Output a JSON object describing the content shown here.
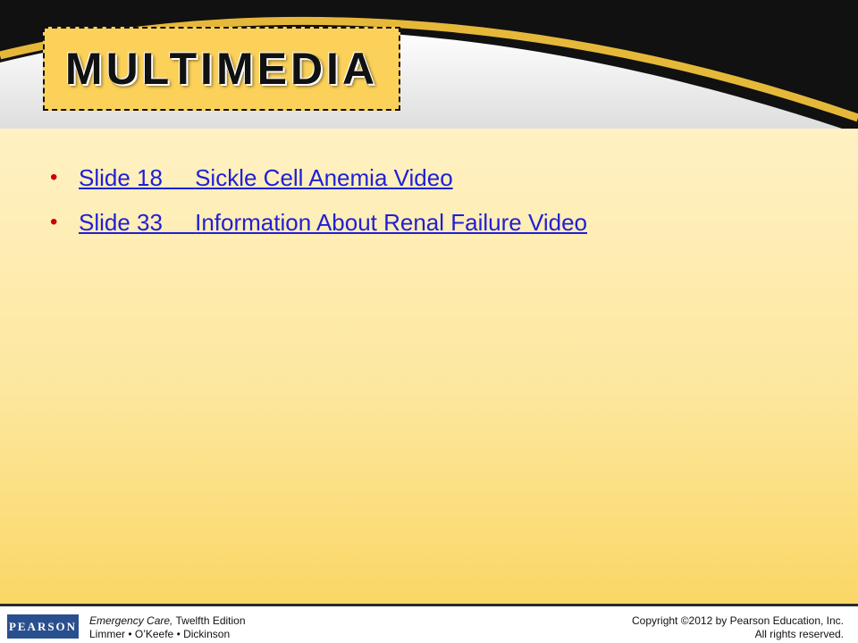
{
  "title": "MULTIMEDIA",
  "links": [
    {
      "slide": "Slide 18",
      "text": "Sickle Cell Anemia Video"
    },
    {
      "slide": "Slide 33",
      "text": "Information About Renal Failure Video"
    }
  ],
  "footer": {
    "logo": "PEARSON",
    "book_title": "Emergency Care,",
    "edition": " Twelfth Edition",
    "authors": "Limmer • O’Keefe • Dickinson",
    "copyright": "Copyright ©2012 by Pearson Education, Inc.",
    "rights": "All rights reserved."
  },
  "colors": {
    "accent": "#fbd15a",
    "link": "#1f1fd6",
    "bullet": "#cc0000",
    "logo_bg": "#2a4f8e"
  }
}
